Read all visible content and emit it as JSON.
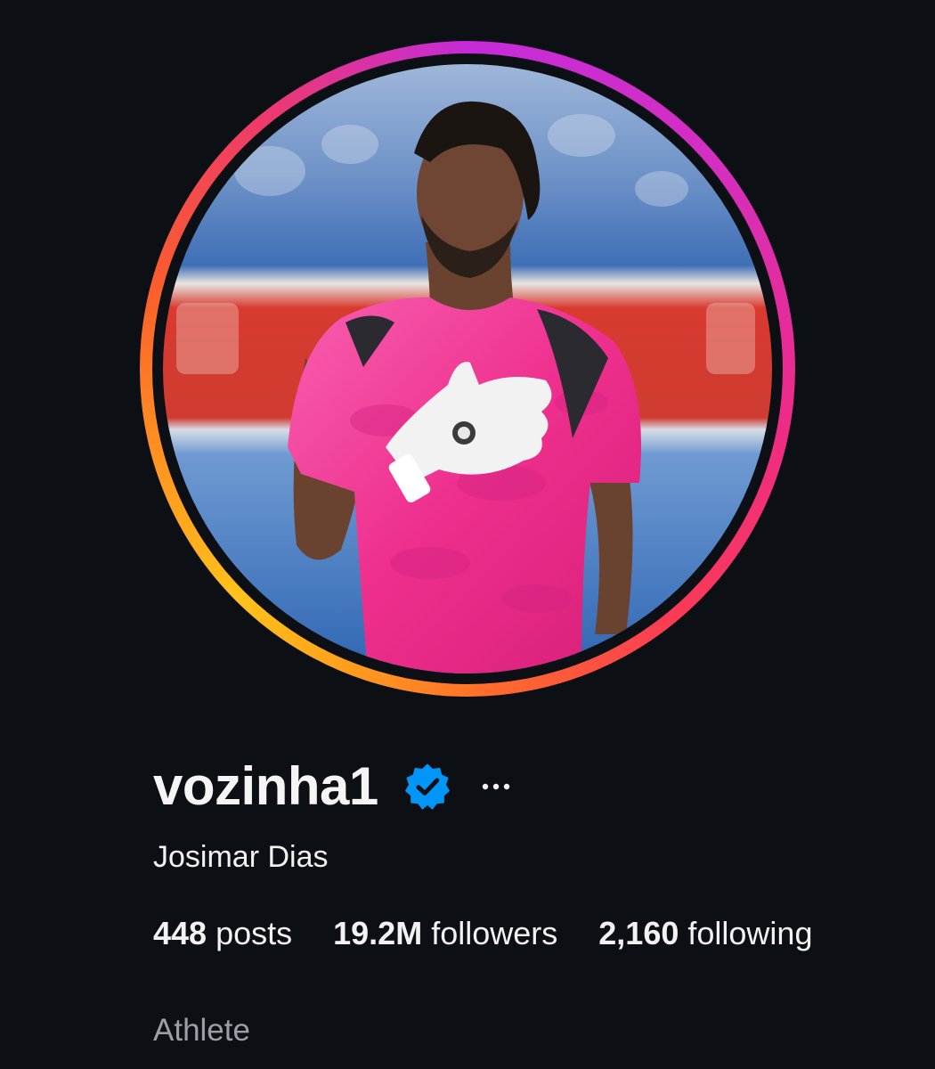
{
  "profile": {
    "username": "vozinha1",
    "full_name": "Josimar Dias",
    "category": "Athlete",
    "verified_icon": "verified-badge-icon",
    "more_icon": "more-options-icon",
    "stats": {
      "posts": {
        "count": "448",
        "label": "posts"
      },
      "followers": {
        "count": "19.2M",
        "label": "followers"
      },
      "following": {
        "count": "2,160",
        "label": "following"
      }
    }
  },
  "theme": {
    "background": "#0c0f14",
    "verified_blue": "#0095f6",
    "category_gray": "#9aa0a6",
    "jersey_pink": "#f0348f"
  }
}
